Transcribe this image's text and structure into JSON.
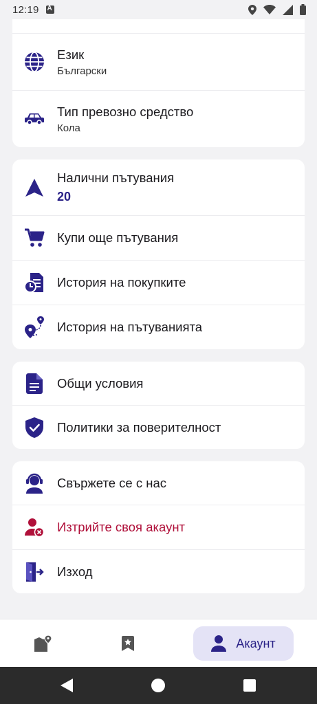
{
  "status_bar": {
    "time": "12:19"
  },
  "settings": {
    "language": {
      "title": "Език",
      "value": "Български",
      "icon": "globe-icon"
    },
    "vehicle_type": {
      "title": "Тип превозно средство",
      "value": "Кола",
      "icon": "car-icon"
    }
  },
  "trips": {
    "available": {
      "title": "Налични пътувания",
      "count": "20",
      "icon": "navigation-arrow-icon"
    },
    "buy_more": {
      "title": "Купи още пътувания",
      "icon": "cart-icon"
    },
    "purchase_history": {
      "title": "История на покупките",
      "icon": "receipt-history-icon"
    },
    "trip_history": {
      "title": "История на пътуванията",
      "icon": "route-pin-icon"
    }
  },
  "legal": {
    "terms": {
      "title": "Общи условия",
      "icon": "document-icon"
    },
    "privacy": {
      "title": "Политики за поверителност",
      "icon": "shield-check-icon"
    }
  },
  "account": {
    "contact": {
      "title": "Свържете се с нас",
      "icon": "support-agent-icon"
    },
    "delete": {
      "title": "Изтрийте своя акаунт",
      "icon": "user-remove-icon"
    },
    "logout": {
      "title": "Изход",
      "icon": "logout-icon"
    }
  },
  "bottom_nav": {
    "items": [
      {
        "icon": "map-pin-icon",
        "label": ""
      },
      {
        "icon": "bookmark-star-icon",
        "label": ""
      },
      {
        "icon": "person-icon",
        "label": "Акаунт",
        "active": true
      }
    ]
  },
  "colors": {
    "accent": "#2b2388",
    "danger": "#b0103a",
    "background": "#f2f2f4",
    "card": "#ffffff"
  }
}
